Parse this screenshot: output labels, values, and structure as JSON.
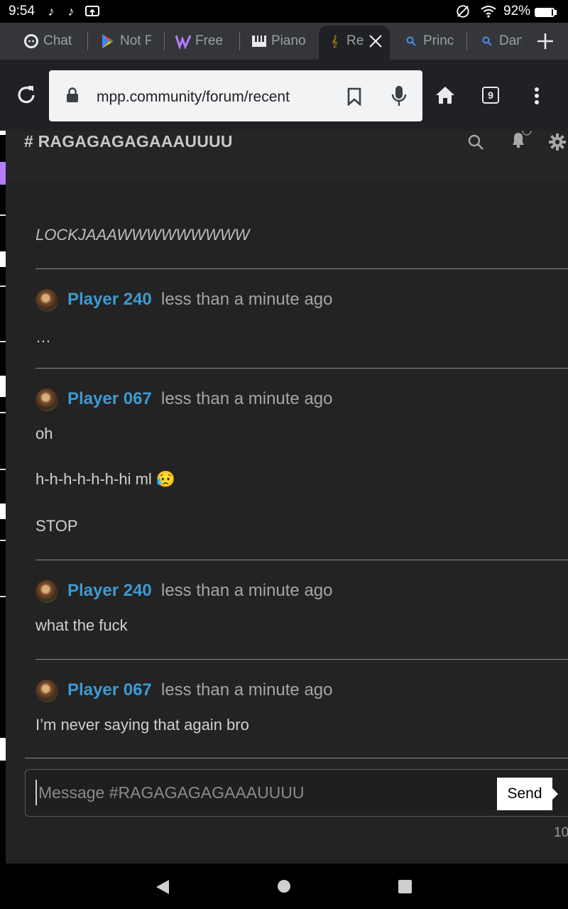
{
  "status_bar": {
    "time": "9:54",
    "battery_percent": "92%",
    "battery_level": 0.92,
    "icons": [
      "tiktok-icon",
      "tiktok-icon",
      "cast-icon",
      "do-not-disturb-icon",
      "wifi-icon",
      "battery-icon"
    ]
  },
  "tabs": [
    {
      "label": "Chat",
      "icon": "chat-favicon"
    },
    {
      "label": "Not F",
      "icon": "play-store-favicon"
    },
    {
      "label": "Free",
      "icon": "free-favicon"
    },
    {
      "label": "Piano",
      "icon": "piano-favicon"
    },
    {
      "label": "Re",
      "icon": "music-note-favicon",
      "active": true
    },
    {
      "label": "Prince",
      "icon": "search-favicon"
    },
    {
      "label": "Dan",
      "icon": "search-favicon"
    }
  ],
  "toolbar": {
    "url": "mpp.community/forum/recent",
    "tab_count": "9"
  },
  "channel": {
    "title": "RAGAGAGAGAAAUUUU"
  },
  "messages": {
    "first_text": "LOCKJAAAWWWWWWWWW",
    "m1": {
      "author": "Player 240",
      "time": "less than a minute ago",
      "lines": [
        "…"
      ]
    },
    "m2": {
      "author": "Player 067",
      "time": "less than a minute ago",
      "lines": [
        "oh",
        "h-h-h-h-h-h-hi ml 😥",
        "STOP"
      ]
    },
    "m3": {
      "author": "Player 240",
      "time": "less than a minute ago",
      "lines": [
        "what the fuck"
      ]
    },
    "m4": {
      "author": "Player 067",
      "time": "less than a minute ago",
      "lines": [
        "I’m never saying that again bro"
      ]
    }
  },
  "composer": {
    "placeholder": "Message #RAGAGAGAGAAAUUUU",
    "send_label": "Send",
    "counter": "10"
  },
  "colors": {
    "author": "#3d9ad1",
    "page_bg": "#232323",
    "toolbar_bg": "#202124"
  }
}
